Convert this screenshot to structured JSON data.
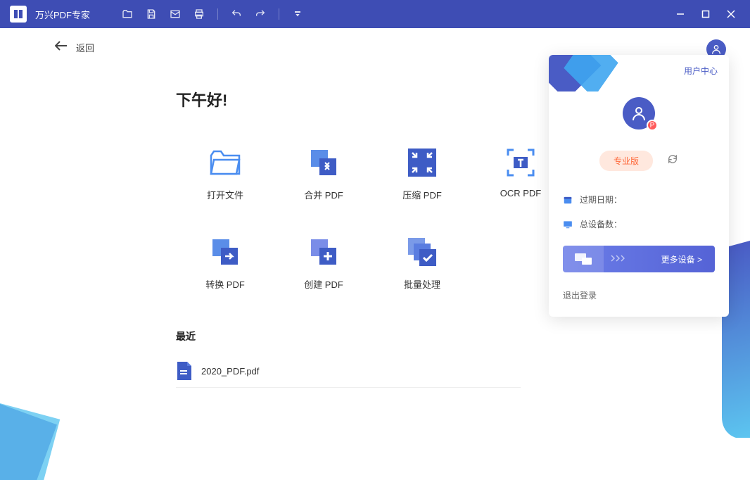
{
  "app": {
    "title": "万兴PDF专家"
  },
  "back": {
    "label": "返回"
  },
  "greeting": "下午好!",
  "tiles": [
    {
      "label": "打开文件"
    },
    {
      "label": "合并 PDF"
    },
    {
      "label": "压缩 PDF"
    },
    {
      "label": "OCR PDF"
    },
    {
      "label": "转换 PDF"
    },
    {
      "label": "创建 PDF"
    },
    {
      "label": "批量处理"
    }
  ],
  "recent": {
    "title": "最近",
    "items": [
      {
        "name": "2020_PDF.pdf"
      }
    ]
  },
  "user_panel": {
    "link": "用户中心",
    "badge_letter": "P",
    "pro_label": "专业版",
    "expire_label": "过期日期：",
    "device_label": "总设备数：",
    "more_devices": "更多设备 >",
    "logout": "退出登录"
  }
}
